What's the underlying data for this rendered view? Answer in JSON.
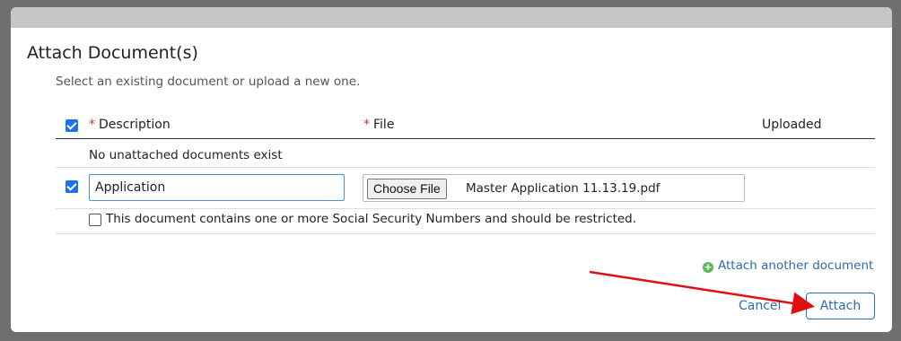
{
  "modal": {
    "title": "Attach Document(s)",
    "subtitle": "Select an existing document or upload a new one."
  },
  "table": {
    "headers": {
      "required_marker": "*",
      "description": "Description",
      "file": "File",
      "uploaded": "Uploaded"
    },
    "select_all_checked": true,
    "empty_message": "No unattached documents exist",
    "new_row": {
      "checked": true,
      "description_value": "Application",
      "choose_file_label": "Choose File",
      "file_name": "Master Application 11.13.19.pdf",
      "ssn_checked": false,
      "ssn_label": "This document contains one or more Social Security Numbers and should be restricted."
    }
  },
  "actions": {
    "attach_another": "Attach another document",
    "cancel": "Cancel",
    "attach": "Attach"
  },
  "colors": {
    "accent": "#2a6db5",
    "checkbox": "#1a73e8",
    "required": "#c0392b",
    "plus_icon": "#5cb85c",
    "annotation_arrow": "#e01010"
  }
}
